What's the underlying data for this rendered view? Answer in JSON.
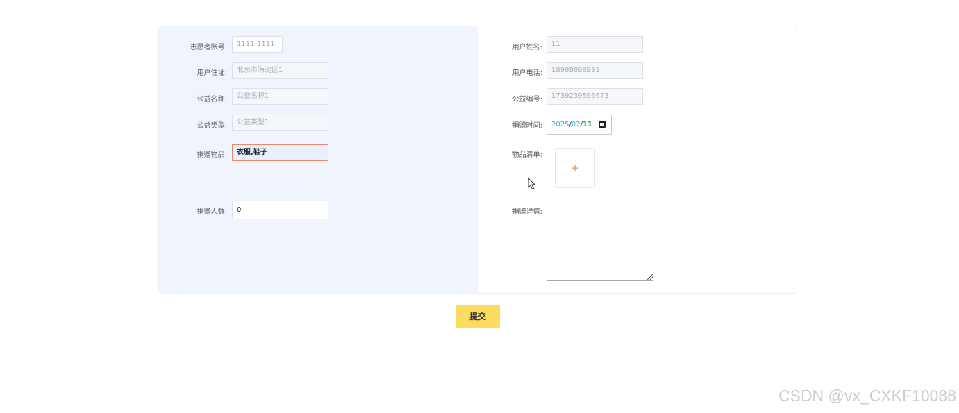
{
  "form": {
    "left": {
      "volunteer_account": {
        "label": "志愿者账号:",
        "value": "1111-1111"
      },
      "user_address": {
        "label": "用户住址:",
        "value": "北京市海淀区1"
      },
      "charity_name": {
        "label": "公益名称:",
        "value": "公益名称1"
      },
      "charity_type": {
        "label": "公益类型:",
        "value": "公益类型1"
      },
      "donated_items": {
        "label": "捐赠物品:",
        "value": "衣服,鞋子"
      },
      "donor_count": {
        "label": "捐赠人数:",
        "value": "0"
      }
    },
    "right": {
      "user_name": {
        "label": "用户姓名:",
        "value": "11"
      },
      "user_phone": {
        "label": "用户电话:",
        "value": "18989898981"
      },
      "charity_number": {
        "label": "公益编号:",
        "value": "1739239593673"
      },
      "donation_time": {
        "label": "捐赠时间:",
        "year": "2025",
        "month": "02",
        "day": "11",
        "separator": "/"
      },
      "item_list": {
        "label": "物品清单:",
        "upload_symbol": "+"
      },
      "donation_details": {
        "label": "捐赠详情:",
        "value": ""
      }
    }
  },
  "submit_label": "提交",
  "watermark": "CSDN @vx_CXKF10088",
  "icons": {
    "calendar": "calendar-icon",
    "upload": "plus-icon",
    "cursor": "mouse-pointer-icon"
  },
  "colors": {
    "left_panel_bg": "#f0f5fd",
    "submit_bg": "#fcdc5e",
    "active_border": "#e8896b",
    "upload_plus": "#f08a4b"
  }
}
